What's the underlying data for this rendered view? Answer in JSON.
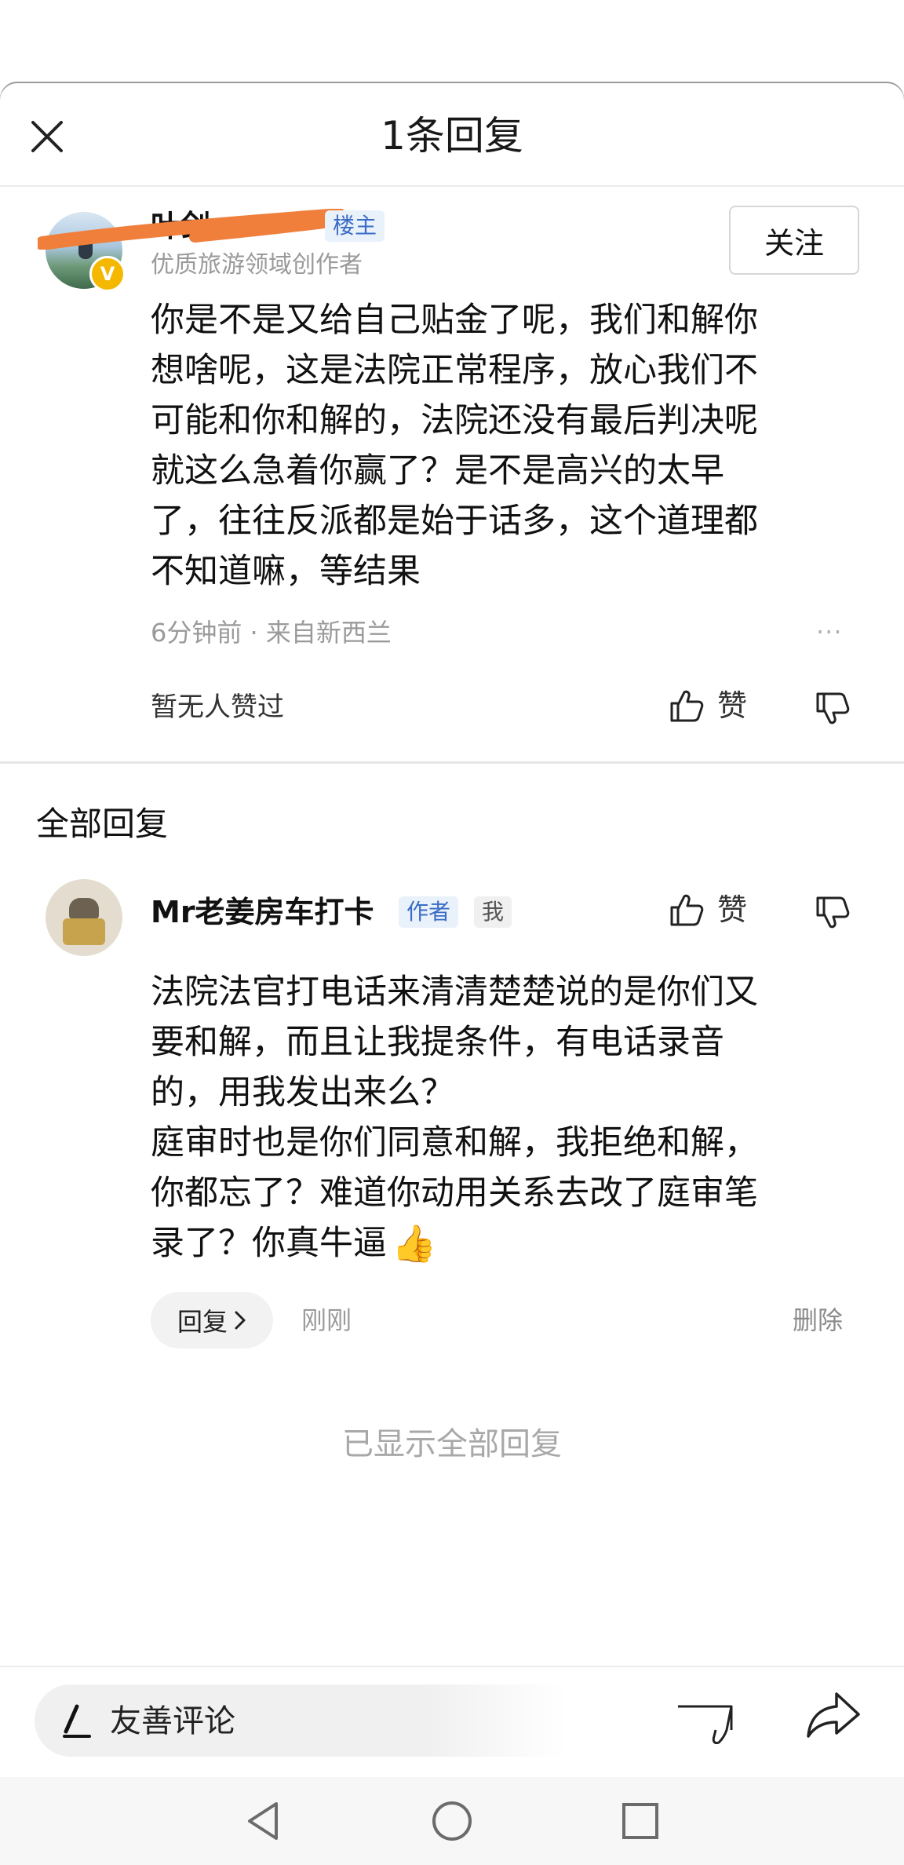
{
  "header": {
    "title": "1条回复"
  },
  "original_comment": {
    "author_name": "叶剑",
    "owner_tag": "楼主",
    "author_subtitle": "优质旅游领域创作者",
    "follow_label": "关注",
    "verified_badge": "V",
    "text_lines": [
      "你是不是又给自己贴金了呢，我们和解你",
      "想啥呢，这是法院正常程序，放心我们不",
      "可能和你和解的，法院还没有最后判决呢",
      "就这么急着你赢了？是不是高兴的太早",
      "了，往往反派都是始于话多，这个道理都",
      "不知道嘛，等结果"
    ],
    "meta": "6分钟前 · 来自新西兰",
    "more_icon": "···",
    "no_likes_text": "暂无人赞过",
    "like_label": "赞"
  },
  "all_replies": {
    "section_title": "全部回复",
    "items": [
      {
        "author_name": "Mr老姜房车打卡",
        "author_tag": "作者",
        "me_tag": "我",
        "like_label": "赞",
        "text_lines": [
          "法院法官打电话来清清楚楚说的是你们又",
          "要和解，而且让我提条件，有电话录音",
          "的，用我发出来么？",
          "庭审时也是你们同意和解，我拒绝和解，",
          "你都忘了？难道你动用关系去改了庭审笔",
          "录了？你真牛逼"
        ],
        "emoji": "👍",
        "reply_button_label": "回复",
        "time": "刚刚",
        "delete_label": "删除"
      }
    ],
    "end_text": "已显示全部回复"
  },
  "composer": {
    "placeholder": "友善评论"
  },
  "colors": {
    "accent_blue": "#3a6cc6",
    "secondary_text": "#9a9a9a",
    "verified_gold": "#f5b800",
    "redaction_orange": "#f07f3c"
  },
  "icons": [
    "close-icon",
    "thumbs-up-icon",
    "thumbs-down-icon",
    "pen-icon",
    "share-icon",
    "nav-back-icon",
    "nav-home-icon",
    "nav-recents-icon"
  ]
}
